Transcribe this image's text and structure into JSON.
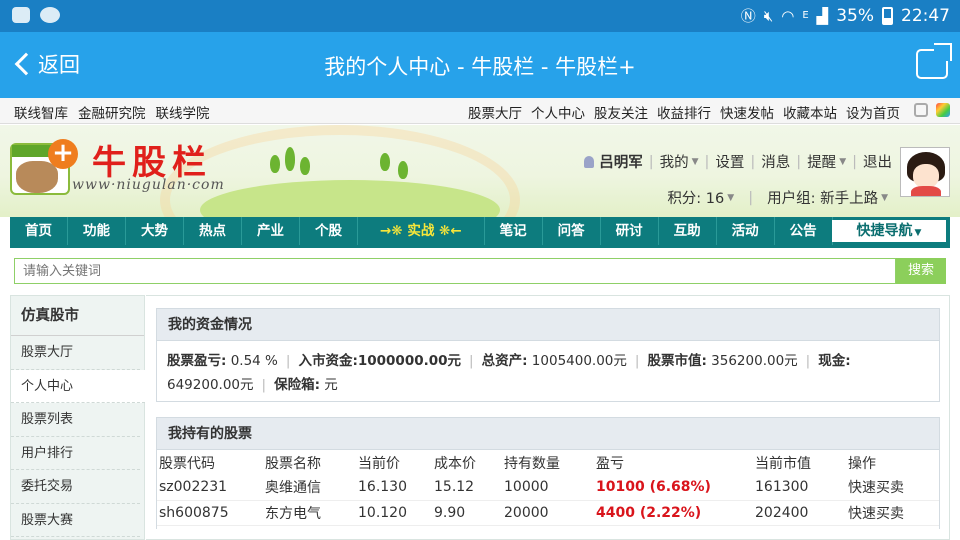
{
  "status_bar": {
    "battery": "35%",
    "time": "22:47",
    "network": "E"
  },
  "app_bar": {
    "back_label": "返回",
    "title": "我的个人中心 - 牛股栏 - 牛股栏+"
  },
  "top_links": {
    "left": [
      "联线智库",
      "金融研究院",
      "联线学院"
    ],
    "right": [
      "股票大厅",
      "个人中心",
      "股友关注",
      "收益排行",
      "快速发帖",
      "收藏本站",
      "设为首页"
    ]
  },
  "brand": {
    "title": "牛股栏",
    "url": "www·niugulan·com"
  },
  "user_bar": {
    "username": "吕明军",
    "menu": [
      "我的",
      "设置",
      "消息",
      "提醒",
      "退出"
    ],
    "score": "积分: 16",
    "group": "用户组: 新手上路"
  },
  "nav": {
    "items": [
      "首页",
      "功能",
      "大势",
      "热点",
      "产业",
      "个股",
      "→❋ 实战 ❋←",
      "笔记",
      "问答",
      "研讨",
      "互助",
      "活动",
      "公告"
    ],
    "quick_nav": "快捷导航"
  },
  "search": {
    "placeholder": "请输入关键词",
    "button": "搜索"
  },
  "sidebar": {
    "title": "仿真股市",
    "items": [
      "股票大厅",
      "个人中心",
      "股票列表",
      "用户排行",
      "委托交易",
      "股票大赛"
    ],
    "active": "个人中心"
  },
  "funds": {
    "title": "我的资金情况",
    "profit_label": "股票盈亏:",
    "profit_value": "0.54 %",
    "capital_label": "入市资金:",
    "capital_value": "1000000.00元",
    "assets_label": "总资产:",
    "assets_value": "1005400.00元",
    "market_label": "股票市值:",
    "market_value": "356200.00元",
    "cash_label": "现金:",
    "cash_value": "649200.00元",
    "safe_label": "保险箱:",
    "safe_value": "元"
  },
  "holdings": {
    "title": "我持有的股票",
    "columns": [
      "股票代码",
      "股票名称",
      "当前价",
      "成本价",
      "持有数量",
      "盈亏",
      "当前市值",
      "操作"
    ],
    "rows": [
      {
        "code": "sz002231",
        "name": "奥维通信",
        "price": "16.130",
        "cost": "15.12",
        "qty": "10000",
        "pl": "10100 (6.68%)",
        "value": "161300",
        "action": "快速买卖"
      },
      {
        "code": "sh600875",
        "name": "东方电气",
        "price": "10.120",
        "cost": "9.90",
        "qty": "20000",
        "pl": "4400 (2.22%)",
        "value": "202400",
        "action": "快速买卖"
      }
    ]
  },
  "colors": {
    "app_bar": "#27a2ea",
    "nav": "#0d7c7e",
    "profit": "#d9141b",
    "search": "#8ccf5b"
  }
}
